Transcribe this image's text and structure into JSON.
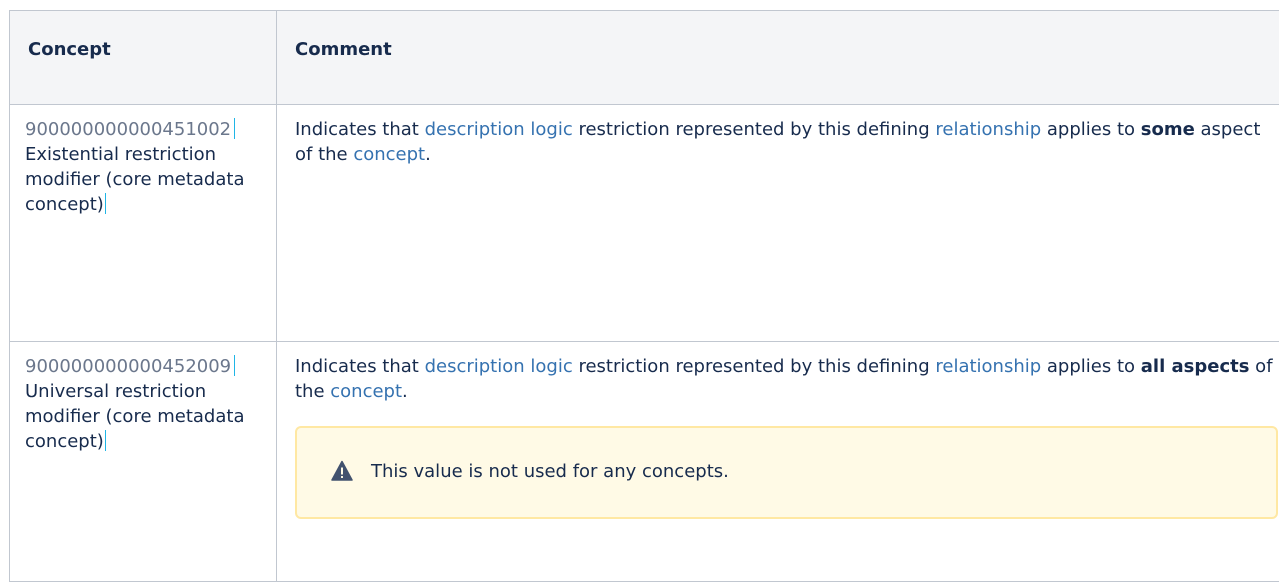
{
  "table": {
    "headers": [
      "Concept",
      "Comment"
    ],
    "rows": [
      {
        "concept_id": "900000000000451002",
        "concept_name": "Existential restriction modifier (core metadata concept)",
        "comment": {
          "prefix": "Indicates that ",
          "link1": "description logic",
          "mid1": " restriction represented by this defining ",
          "link2": "relationship",
          "mid2": " applies to ",
          "bold": "some",
          "mid3": " aspect of the ",
          "link3": "concept",
          "suffix": "."
        }
      },
      {
        "concept_id": "900000000000452009",
        "concept_name": "Universal restriction modifier (core metadata concept)",
        "comment": {
          "prefix": "Indicates that ",
          "link1": "description logic",
          "mid1": " restriction represented by this defining ",
          "link2": "relationship",
          "mid2": " applies to ",
          "bold": "all aspects",
          "mid3": " of the ",
          "link3": "concept",
          "suffix": "."
        },
        "warning": {
          "icon": "warning-triangle-icon",
          "text": "This value is not used for any concepts."
        }
      }
    ]
  },
  "colors": {
    "link": "#3572b0",
    "warning_bg": "#fffae6",
    "warning_border": "#ffe8a3",
    "header_bg": "#f4f5f7"
  }
}
